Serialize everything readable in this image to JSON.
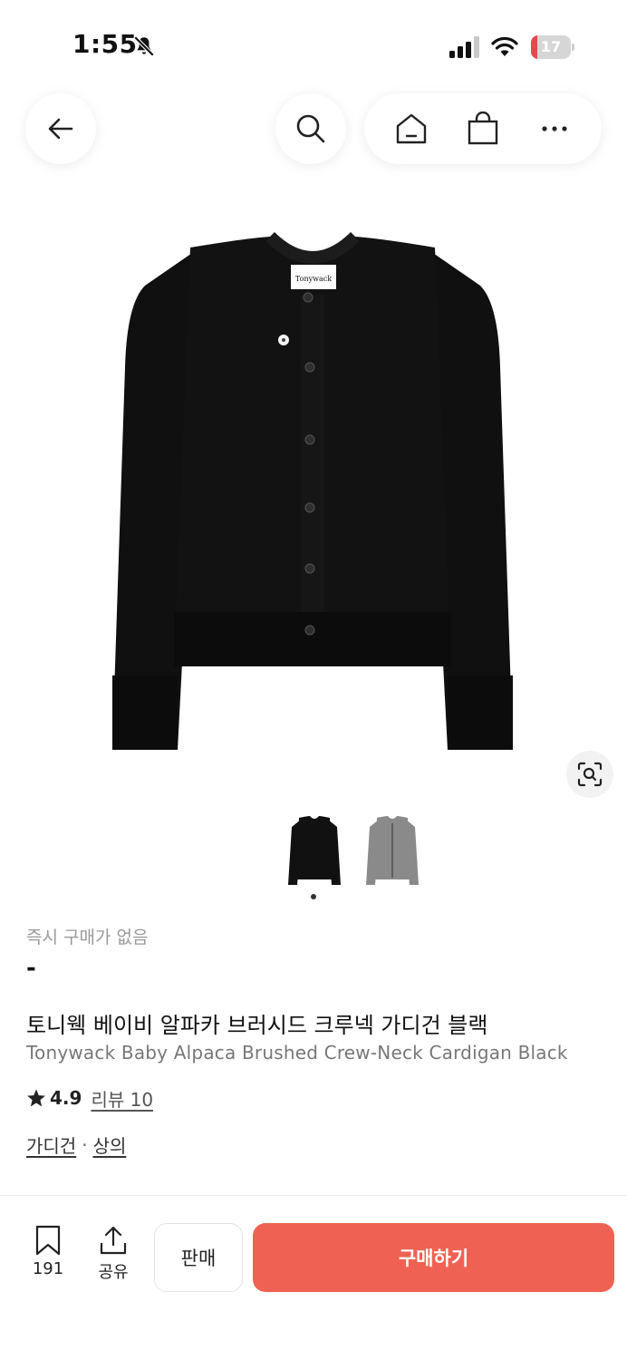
{
  "status_bar": {
    "time": "1:55",
    "battery_percent": "17",
    "battery_level": 0.17
  },
  "nav": {
    "icons": [
      "back-arrow-icon",
      "search-icon",
      "home-icon",
      "shopping-bag-icon",
      "more-icon"
    ]
  },
  "product": {
    "thumbnail_colors": [
      "#111111",
      "#8a8a8a"
    ],
    "active_thumbnail_index": 0,
    "instant_purchase_label": "즉시 구매가 없음",
    "price": "-",
    "title_ko": "토니웩 베이비 알파카 브러시드 크루넥 가디건 블랙",
    "title_en": "Tonywack Baby Alpaca Brushed Crew-Neck Cardigan Black",
    "rating": "4.9",
    "review_label": "리뷰 10",
    "categories": [
      "가디건",
      "상의"
    ],
    "category_separator": "·",
    "brand_tag": "Tonywack"
  },
  "bottom_bar": {
    "bookmark_count": "191",
    "share_label": "공유",
    "sell_label": "판매",
    "buy_label": "구매하기"
  },
  "colors": {
    "accent": "#ef6253",
    "text_primary": "#111111",
    "text_secondary": "#777777"
  }
}
